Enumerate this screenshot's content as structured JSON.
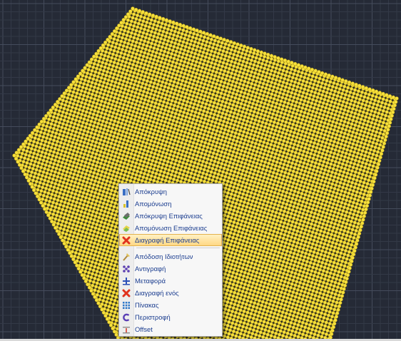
{
  "viewport": {
    "background": "#252a36",
    "grid_minor_color": "#333947",
    "grid_major_color": "#454c5c",
    "point_color": "#f6e03c",
    "point_outline": "#b89c10",
    "hole_color": "#2a2a22"
  },
  "context_menu": {
    "group1": [
      {
        "label": "Απόκρυψη",
        "icon": "hide-icon"
      },
      {
        "label": "Απομόνωση",
        "icon": "isolate-icon"
      },
      {
        "label": "Απόκρυψη Επιφάνειας",
        "icon": "hide-surface-icon"
      },
      {
        "label": "Απομόνωση Επιφάνειας",
        "icon": "isolate-surface-icon"
      },
      {
        "label": "Διαγραφή Επιφάνειας",
        "icon": "delete-surface-icon",
        "highlighted": true
      }
    ],
    "group2": [
      {
        "label": "Απόδοση Ιδιοτήτων",
        "icon": "match-properties-icon"
      },
      {
        "label": "Αντιγραφή",
        "icon": "copy-icon"
      },
      {
        "label": "Μεταφορά",
        "icon": "move-icon"
      },
      {
        "label": "Διαγραφή ενός",
        "icon": "delete-one-icon"
      },
      {
        "label": "Πίνακας",
        "icon": "array-icon"
      },
      {
        "label": "Περιστροφή",
        "icon": "rotate-icon"
      },
      {
        "label": "Offset",
        "icon": "offset-icon"
      }
    ]
  }
}
